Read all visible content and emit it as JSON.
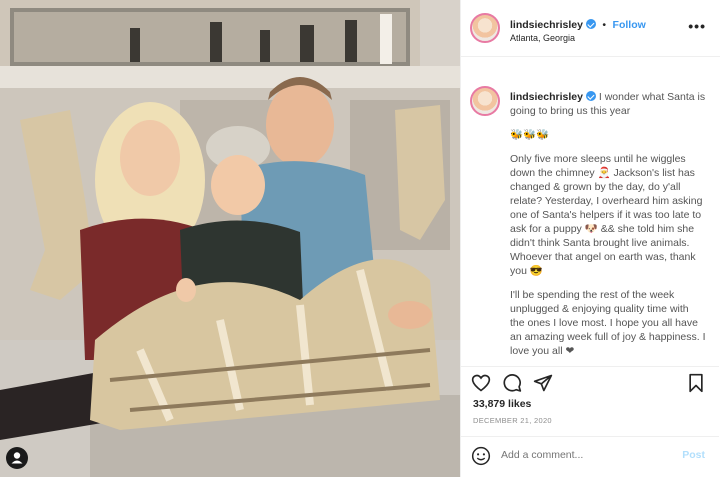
{
  "post": {
    "username": "lindsiechrisley",
    "follow_label": "Follow",
    "dot": "•",
    "location": "Atlanta, Georgia",
    "more_label": "•••",
    "caption": {
      "line1": "I wonder what Santa is going to bring us this year",
      "emojis": "🐝🐝🐝",
      "para2": "Only five more sleeps until he wiggles down the chimney 🎅 Jackson's list has changed & grown by the day, do y'all relate? Yesterday, I overheard him asking one of Santa's helpers if it was too late to ask for a puppy 🐶 && she told him she didn't think Santa brought live animals. Whoever that angel on earth was, thank you 😎",
      "para3": "I'll be spending the rest of the week unplugged & enjoying quality time with the ones I love most. I hope you all have an amazing week full of joy & happiness. I love you all ❤"
    },
    "likes": "33,879 likes",
    "date": "DECEMBER 21, 2020",
    "comment_placeholder": "Add a comment...",
    "post_label": "Post"
  },
  "icons": {
    "heart": "heart-icon",
    "comment": "comment-icon",
    "share": "share-icon",
    "bookmark": "bookmark-icon",
    "emoji": "emoji-icon",
    "user_tag": "user-tag-icon",
    "verified": "verified-badge-icon"
  },
  "colors": {
    "follow": "#3897f0",
    "verified": "#3897f0",
    "avatar_ring": "#e87aa3",
    "post_disabled": "#b2dffc"
  }
}
